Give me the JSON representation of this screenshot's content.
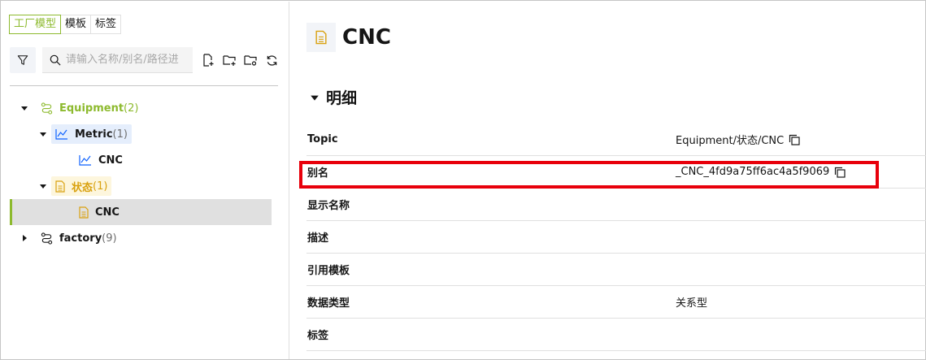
{
  "tabs": [
    {
      "label": "工厂模型",
      "active": true
    },
    {
      "label": "模板",
      "active": false
    },
    {
      "label": "标签",
      "active": false
    }
  ],
  "search": {
    "placeholder": "请输入名称/别名/路径进"
  },
  "tree": {
    "equipment": {
      "label": "Equipment",
      "count": "(2)"
    },
    "metric": {
      "label": "Metric",
      "count": "(1)"
    },
    "metric_cnc": {
      "label": "CNC"
    },
    "state": {
      "label": "状态",
      "count": "(1)"
    },
    "state_cnc": {
      "label": "CNC"
    },
    "factory": {
      "label": "factory",
      "count": "(9)"
    }
  },
  "detail": {
    "title": "CNC",
    "section": "明细",
    "props": [
      {
        "key": "Topic",
        "value": "Equipment/状态/CNC",
        "copy": true
      },
      {
        "key": "别名",
        "value": "_CNC_4fd9a75ff6ac4a5f9069",
        "copy": true
      },
      {
        "key": "显示名称",
        "value": "",
        "copy": false
      },
      {
        "key": "描述",
        "value": "",
        "copy": false
      },
      {
        "key": "引用模板",
        "value": "",
        "copy": false
      },
      {
        "key": "数据类型",
        "value": "关系型",
        "copy": false
      },
      {
        "key": "标签",
        "value": "",
        "copy": false
      }
    ]
  },
  "colors": {
    "accent": "#8dba2e",
    "highlight": "#e8000b",
    "state": "#d9a10f",
    "metric": "#0f62fe"
  }
}
